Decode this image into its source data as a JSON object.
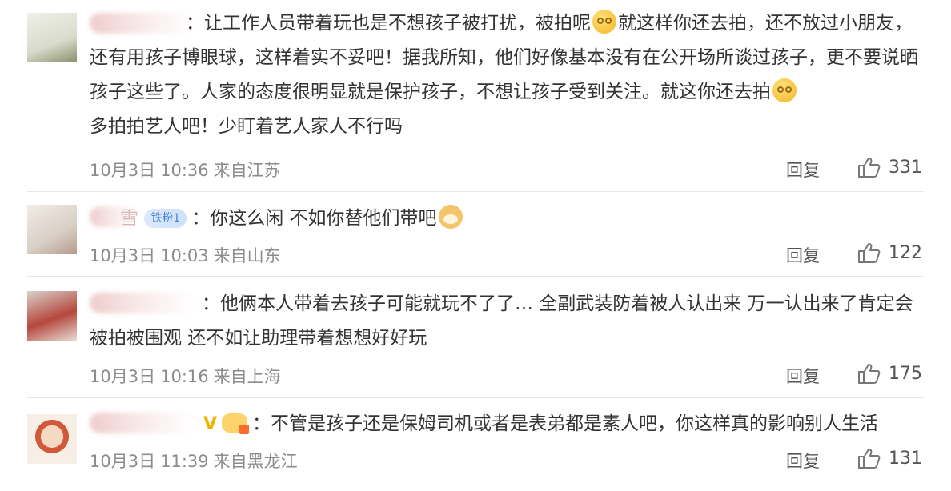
{
  "comments": [
    {
      "text_parts": [
        "：让工作人员带着玩也是不想孩子被打扰，被拍呢",
        "就这样你还去拍，还不放过小朋友，还有用孩子博眼球，这样着实不妥吧！据我所知，他们好像基本没有在公开场所谈过孩子，更不要说晒孩子这些了。人家的态度很明显就是保护孩子，不想让孩子受到关注。就这你还去拍",
        "多拍拍艺人吧！少盯着艺人家人不行吗"
      ],
      "date": "10月3日",
      "time": "10:36",
      "location": "来自江苏",
      "reply_label": "回复",
      "likes": "331"
    },
    {
      "badge": "铁粉1",
      "name_fragment": "雪",
      "text_parts": [
        "：你这么闲 不如你替他们带吧"
      ],
      "date": "10月3日",
      "time": "10:03",
      "location": "来自山东",
      "reply_label": "回复",
      "likes": "122"
    },
    {
      "text_parts": [
        "：他俩本人带着去孩子可能就玩不了了… 全副武装防着被人认出来 万一认出来了肯定会被拍被围观 还不如让助理带着想想好好玩"
      ],
      "date": "10月3日",
      "time": "10:16",
      "location": "来自上海",
      "reply_label": "回复",
      "likes": "175"
    },
    {
      "verified": "V",
      "text_parts": [
        "：不管是孩子还是保姆司机或者是表弟都是素人吧，你这样真的影响别人生活"
      ],
      "date": "10月3日",
      "time": "11:39",
      "location": "来自黑龙江",
      "reply_label": "回复",
      "likes": "131"
    }
  ],
  "icons": {
    "like": "thumbs-up-icon",
    "emoji_dizzy": "dizzy-face-emoji-icon",
    "emoji_dog": "doge-emoji-icon",
    "fans_badge": "fan-badge-icon",
    "verified": "verified-v-icon",
    "gold_badge": "gold-badge-icon"
  },
  "colors": {
    "meta_text": "#8c8c8c",
    "body_text": "#333333",
    "fans_badge": "#4a86d8",
    "verified": "#f2b300"
  }
}
